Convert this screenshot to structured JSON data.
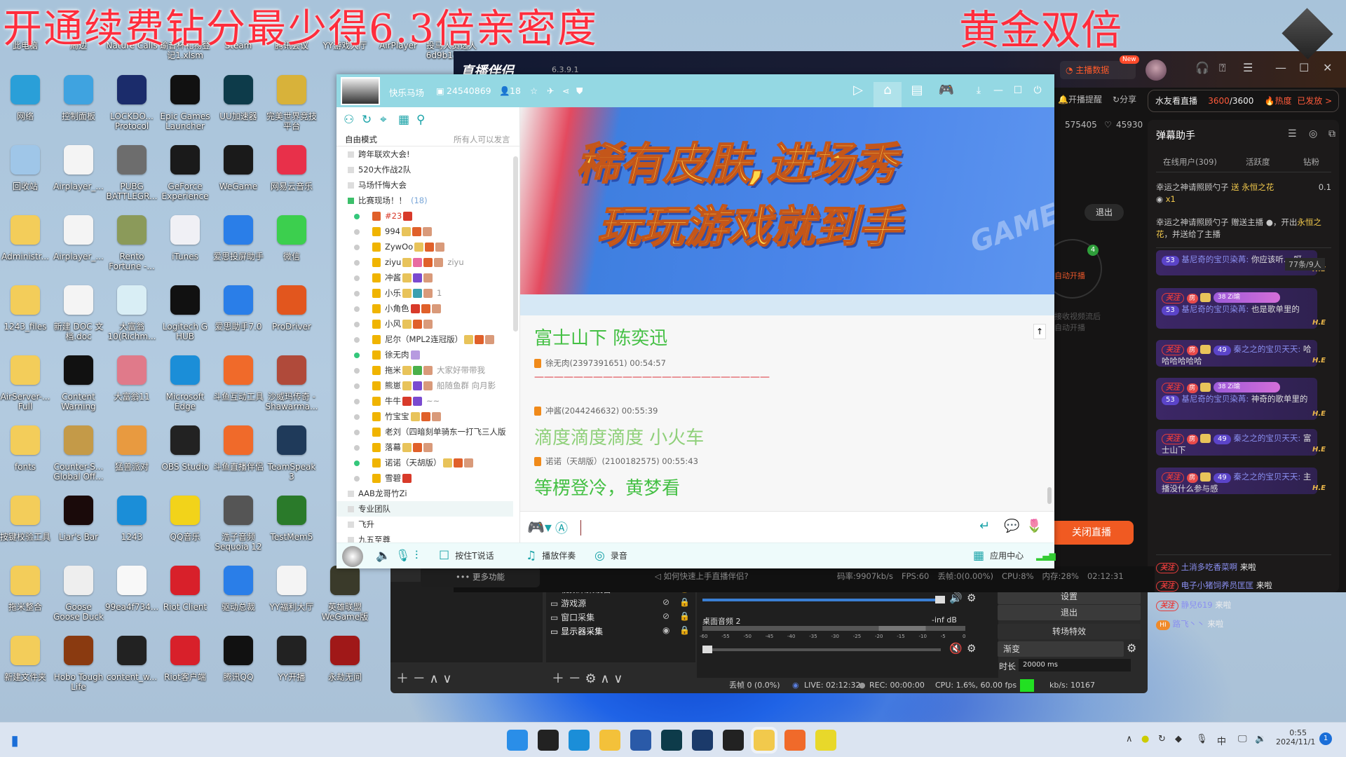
{
  "desktop": {
    "top_banner": "开通续费钻分最少得6.3倍亲密度",
    "right_banner": "黄金双倍",
    "row0": [
      "此电脑",
      "周边",
      "Nature Calls",
      "瑜音杯礼物登记1.xlsm",
      "Steam",
      "腾讯会议",
      "YY游戏大厅",
      "AirPlayer",
      "投马人员选人 6d9b1586..."
    ],
    "icons": [
      [
        {
          "label": "网络",
          "color": "#2a9fd8"
        },
        {
          "label": "控制面板",
          "color": "#3fa3e0"
        },
        {
          "label": "LOCKDO... Protocol",
          "color": "#1b2c6b"
        },
        {
          "label": "Epic Games Launcher",
          "color": "#111111"
        },
        {
          "label": "UU加速器",
          "color": "#0d3b4a"
        },
        {
          "label": "完美世界竞技平台",
          "color": "#d8b23a"
        }
      ],
      [
        {
          "label": "回收站",
          "color": "#9fc6e8"
        },
        {
          "label": "Airplayer_...",
          "color": "#f4f4f4"
        },
        {
          "label": "PUBG BATTLEGR...",
          "color": "#6d6d6d"
        },
        {
          "label": "GeForce Experience",
          "color": "#1a1a1a"
        },
        {
          "label": "WeGame",
          "color": "#1a1a1a"
        },
        {
          "label": "网易云音乐",
          "color": "#e8304a"
        }
      ],
      [
        {
          "label": "Administr...",
          "color": "#f3cd5a"
        },
        {
          "label": "Airplayer_...",
          "color": "#f4f4f4"
        },
        {
          "label": "Rento Fortune -...",
          "color": "#8b9a5a"
        },
        {
          "label": "iTunes",
          "color": "#f0f0f5"
        },
        {
          "label": "爱思投屏助手",
          "color": "#2a7ee8"
        },
        {
          "label": "微信",
          "color": "#3ccf4e"
        }
      ],
      [
        {
          "label": "1243_files",
          "color": "#f3cd5a"
        },
        {
          "label": "新建 DOC 文档.doc",
          "color": "#f4f4f4"
        },
        {
          "label": "大富翁10(Richm...",
          "color": "#d9eef5"
        },
        {
          "label": "Logitech G HUB",
          "color": "#111111"
        },
        {
          "label": "爱思助手7.0",
          "color": "#2a7ee8"
        },
        {
          "label": "ProDriver",
          "color": "#e2561e"
        }
      ],
      [
        {
          "label": "AirServer-... Full",
          "color": "#f3cd5a"
        },
        {
          "label": "Content Warning",
          "color": "#111111"
        },
        {
          "label": "大富翁11",
          "color": "#e07a8a"
        },
        {
          "label": "Microsoft Edge",
          "color": "#1b8ed8"
        },
        {
          "label": "斗鱼互动工具",
          "color": "#f06a2a"
        },
        {
          "label": "沙威玛传奇 - Shawarma...",
          "color": "#b04a3a"
        }
      ],
      [
        {
          "label": "fonts",
          "color": "#f3cd5a"
        },
        {
          "label": "Counter-S... Global Off...",
          "color": "#c49a48"
        },
        {
          "label": "猛兽派对",
          "color": "#e89a40"
        },
        {
          "label": "OBS Studio",
          "color": "#222222"
        },
        {
          "label": "斗鱼直播伴侣",
          "color": "#f06a2a"
        },
        {
          "label": "TeamSpeak 3",
          "color": "#1f3a5a"
        }
      ],
      [
        {
          "label": "按键校验工具",
          "color": "#f3cd5a"
        },
        {
          "label": "Liar's Bar",
          "color": "#1a0a0a"
        },
        {
          "label": "1243",
          "color": "#1b8ed8"
        },
        {
          "label": "QQ音乐",
          "color": "#f2d31a"
        },
        {
          "label": "浩子音频 Sequoia 12",
          "color": "#555555"
        },
        {
          "label": "TestMem5",
          "color": "#2a7a2a"
        }
      ],
      [
        {
          "label": "拖米整合",
          "color": "#f3cd5a"
        },
        {
          "label": "Goose Goose Duck",
          "color": "#eeeeee"
        },
        {
          "label": "99ea4f734...",
          "color": "#f8f8f8"
        },
        {
          "label": "Riot Client",
          "color": "#d8202a"
        },
        {
          "label": "驱动总裁",
          "color": "#2a7ee8"
        },
        {
          "label": "YY福利大厅",
          "color": "#f4f4f4"
        },
        {
          "label": "英雄联盟WeGame版",
          "color": "#3a3a2a"
        }
      ],
      [
        {
          "label": "新建文件夹",
          "color": "#f3cd5a"
        },
        {
          "label": "Hobo Tough Life",
          "color": "#8a3a10"
        },
        {
          "label": "content_w...",
          "color": "#222222"
        },
        {
          "label": "Riot客户端",
          "color": "#d8202a"
        },
        {
          "label": "腾讯QQ",
          "color": "#111111"
        },
        {
          "label": "YY开播",
          "color": "#222222"
        },
        {
          "label": "永劫无间",
          "color": "#a01818"
        }
      ]
    ]
  },
  "douyu": {
    "title": "直播伴侣",
    "version": "6.3.9.1",
    "anchor_data": "主播数据",
    "new_badge": "New",
    "reminder": "开播提醒",
    "share": "分享",
    "views": "575405",
    "likes": "45930",
    "exit": "退出",
    "auto_start": "自动开播",
    "auto_badge": "4",
    "hint_1": "接收视频流后",
    "hint_2": "自动开播",
    "close_live": "关闭直播",
    "more": "••• 更多功能",
    "help": "如何快速上手直播伴侣?",
    "stats": [
      "码率:9907kb/s",
      "FPS:60",
      "丢帧:0(0.00%)",
      "CPU:8%",
      "内存:28%",
      "02:12:31"
    ],
    "water": {
      "label": "水友看直播",
      "current": "3600",
      "total": "/3600",
      "heat": "热度",
      "issued": "已发放 >"
    },
    "danmaku": {
      "title": "弹幕助手",
      "tabs": [
        "在线用户(309)",
        "活跃度",
        "钻粉"
      ],
      "gift_1": {
        "text": "幸运之神请照顾勺子 ",
        "gift": "送 永恒之花",
        "value": "0.1",
        "count": "x1"
      },
      "gift_2": {
        "text": "幸运之神请照顾勺子 赠送主播 ",
        "mid": "，开出",
        "gift": "永恒之花",
        "tail": "，并送给了主播"
      },
      "counter": "77条/9人",
      "follow": "关注",
      "room": "房",
      "he": "H.E",
      "cards": [
        {
          "level": "53",
          "user": "基尼奇的宝贝染苒:",
          "text": "你应该听... 呀",
          "fan": ""
        },
        {
          "level": "53",
          "user": "基尼奇的宝贝染苒:",
          "text": "也是歌单里的",
          "fan": "38 Zi瑜"
        },
        {
          "level": "49",
          "user": "秦之之的宝贝天天:",
          "text": "哈哈哈哈哈哈",
          "fan": ""
        },
        {
          "level": "53",
          "user": "基尼奇的宝贝染苒:",
          "text": "神奇的歌单里的",
          "fan": "38 Zi瑜"
        },
        {
          "level": "49",
          "user": "秦之之的宝贝天天:",
          "text": "富士山下",
          "fan": ""
        },
        {
          "level": "49",
          "user": "秦之之的宝贝天天:",
          "text": "主播没什么参与感",
          "fan": ""
        }
      ],
      "entries": [
        {
          "tag": "关注",
          "user": "土消多吃香菜啊",
          "text": "来啦"
        },
        {
          "tag": "关注",
          "user": "电子小猪饲养员匡匡",
          "text": "来啦"
        },
        {
          "tag": "关注",
          "user": "静兒619",
          "text": "来啦"
        },
        {
          "tag": "HI",
          "user": "路飞丶丶",
          "text": "来啦"
        }
      ]
    }
  },
  "yy": {
    "channel_name": "快乐马场",
    "channel_id": "24540869",
    "online_count": "18",
    "mode": "自由模式",
    "speak_rule": "所有人可以发言",
    "groups_top": [
      "跨年联欢大会!",
      "520大作战2队",
      "马场忏悔大会"
    ],
    "current_group": {
      "name": "比赛现场！！",
      "count": "(18)"
    },
    "members": [
      {
        "name": "#23",
        "online": true,
        "note": "",
        "badges": [
          "#d83a2a"
        ]
      },
      {
        "name": "994",
        "online": false,
        "note": "",
        "badges": [
          "#e8c35a",
          "#e0602a",
          "#d99a7a"
        ]
      },
      {
        "name": "ZywOo",
        "online": false,
        "note": "",
        "badges": [
          "#e8c35a",
          "#e0602a",
          "#d99a7a"
        ]
      },
      {
        "name": "ziyu",
        "online": false,
        "note": "ziyu",
        "badges": [
          "#e8c35a",
          "#e86aa0",
          "#e0602a",
          "#d99a7a"
        ]
      },
      {
        "name": "冲酱",
        "online": false,
        "note": "",
        "badges": [
          "#e8c35a",
          "#7a4ad0",
          "#d99a7a"
        ]
      },
      {
        "name": "小乐",
        "online": false,
        "note": "1",
        "badges": [
          "#e8c35a",
          "#3aa0b0",
          "#d99a7a"
        ]
      },
      {
        "name": "小角色",
        "online": false,
        "note": "",
        "badges": [
          "#d83a2a",
          "#e0602a",
          "#d99a7a"
        ]
      },
      {
        "name": "小风",
        "online": false,
        "note": "",
        "badges": [
          "#e8c35a",
          "#e0602a",
          "#d99a7a"
        ]
      },
      {
        "name": "尼尔（MPL2连冠版）",
        "online": false,
        "note": "",
        "badges": [
          "#e8c35a",
          "#e0602a",
          "#d99a7a"
        ]
      },
      {
        "name": "徐无肉",
        "online": true,
        "note": "",
        "badges": [
          "#b79ae0"
        ]
      },
      {
        "name": "拖米",
        "online": false,
        "note": "大家好带带我",
        "badges": [
          "#e8c35a",
          "#4ab04a",
          "#d99a7a"
        ]
      },
      {
        "name": "熊崽",
        "online": false,
        "note": "船随鱼群 向月影",
        "badges": [
          "#e8c35a",
          "#7a4ad0",
          "#d99a7a"
        ]
      },
      {
        "name": "牛牛",
        "online": false,
        "note": "~~",
        "badges": [
          "#d83a2a",
          "#7a4ad0"
        ]
      },
      {
        "name": "竹宝宝",
        "online": false,
        "note": "",
        "badges": [
          "#e8c35a",
          "#e0602a",
          "#d99a7a"
        ]
      },
      {
        "name": "老刘（四暗刻单骑东一打飞三人版",
        "online": false,
        "note": "",
        "badges": []
      },
      {
        "name": "落幕",
        "online": false,
        "note": "",
        "badges": [
          "#e8c35a",
          "#e0602a",
          "#d99a7a"
        ]
      },
      {
        "name": "诺诺（天胡版）",
        "online": true,
        "note": "",
        "badges": [
          "#e8c35a",
          "#e0602a",
          "#d99a7a"
        ]
      },
      {
        "name": "雪碧",
        "online": false,
        "note": "",
        "badges": [
          "#d83a2a"
        ]
      }
    ],
    "groups_bottom": [
      "AAB龙哥竹Zi",
      "专业团队",
      "飞升",
      "九五至尊"
    ],
    "banner": {
      "line_1": "稀有皮肤,进场秀",
      "line_2": "玩玩游戏就到手",
      "mark": "GAME"
    },
    "chat": [
      {
        "type": "big",
        "text": "富士山下  陈奕迅",
        "color": "#45c045"
      },
      {
        "type": "meta",
        "text": "徐无肉(2397391651)  00:54:57"
      },
      {
        "type": "line",
        "text": "————————————————————————",
        "color": "#d8202a"
      },
      {
        "type": "meta",
        "text": "冲酱(2044246632)  00:55:39"
      },
      {
        "type": "big",
        "text": "滴度滴度滴度  小火车",
        "color": "#8fd07a"
      },
      {
        "type": "meta",
        "text": "诺诺（天胡版）(2100182575)  00:55:43"
      },
      {
        "type": "big",
        "text": "等楞登冷，黄梦看",
        "color": "#45c045"
      }
    ],
    "toolbar": {
      "push_to_talk": "按住T说话",
      "play_music": "播放伴奏",
      "record": "录音",
      "app_center": "应用中心"
    }
  },
  "obs": {
    "sources": [
      {
        "name": "视频采集设备",
        "visible": false
      },
      {
        "name": "游戏源",
        "visible": false
      },
      {
        "name": "窗口采集",
        "visible": false
      },
      {
        "name": "显示器采集",
        "visible": true
      }
    ],
    "mixer_track": "桌面音频 2",
    "mixer_db": "-inf dB",
    "meter_ticks": [
      "-60",
      "-55",
      "-50",
      "-45",
      "-40",
      "-35",
      "-30",
      "-25",
      "-20",
      "-15",
      "-10",
      "-5",
      "0"
    ],
    "settings": "设置",
    "exit": "退出",
    "transitions": "转场特效",
    "transition_value": "渐变",
    "duration_label": "时长",
    "duration_value": "20000 ms",
    "status": {
      "dropped": "丢帧 0 (0.0%)",
      "live": "LIVE: 02:12:32",
      "rec": "REC: 00:00:00",
      "cpu": "CPU: 1.6%, 60.00 fps",
      "kbps": "kb/s: 10167"
    }
  },
  "taskbar": {
    "ime": "中",
    "time": "0:55",
    "date": "2024/11/1",
    "notifications": "1"
  }
}
